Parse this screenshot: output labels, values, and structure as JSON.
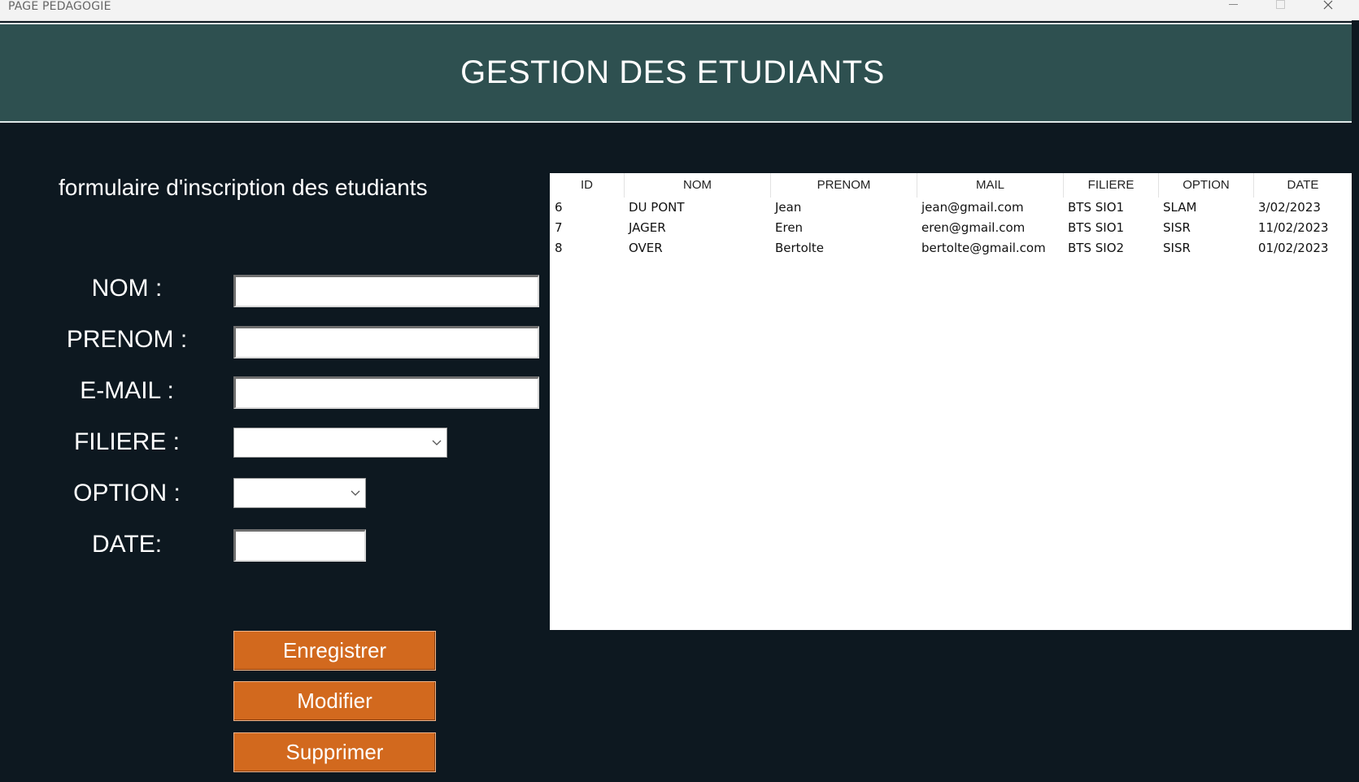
{
  "window": {
    "title": "PAGE PEDAGOGIE"
  },
  "header": {
    "title": "GESTION DES ETUDIANTS"
  },
  "form": {
    "title": "formulaire d'inscription des etudiants",
    "labels": {
      "nom": "NOM :",
      "prenom": "PRENOM :",
      "email": "E-MAIL :",
      "filiere": "FILIERE :",
      "option": "OPTION :",
      "date": "DATE:"
    },
    "values": {
      "nom": "",
      "prenom": "",
      "email": "",
      "filiere": "",
      "option": "",
      "date": ""
    }
  },
  "buttons": {
    "save": "Enregistrer",
    "modify": "Modifier",
    "delete": "Supprimer"
  },
  "table": {
    "columns": [
      "ID",
      "NOM",
      "PRENOM",
      "MAIL",
      "FILIERE",
      "OPTION",
      "DATE"
    ],
    "rows": [
      [
        "6",
        "DU PONT",
        "Jean",
        "jean@gmail.com",
        "BTS SIO1",
        "SLAM",
        "3/02/2023"
      ],
      [
        "7",
        "JAGER",
        "Eren",
        "eren@gmail.com",
        "BTS SIO1",
        "SISR",
        "11/02/2023"
      ],
      [
        "8",
        "OVER",
        "Bertolte",
        "bertolte@gmail.com",
        "BTS SIO2",
        "SISR",
        "01/02/2023"
      ]
    ]
  },
  "colors": {
    "background": "#0d1820",
    "header": "#2e5050",
    "button": "#d2691e"
  }
}
